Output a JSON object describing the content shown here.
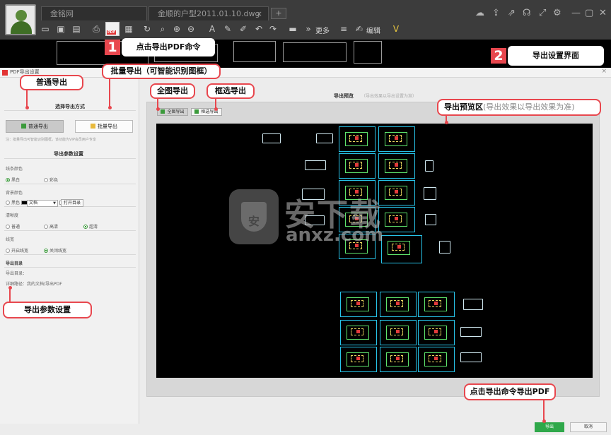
{
  "tabs": [
    {
      "label": "金铭网"
    },
    {
      "label": "金顺的户型2011.01.10.dwg",
      "close": "×"
    }
  ],
  "tab_add": "+",
  "toolbar": {
    "more_label": "更多",
    "edit_label": "编辑",
    "pdf_tag": "PDF"
  },
  "callouts": {
    "step1_number": "1",
    "step1_text": "点击导出PDF命令",
    "step2_number": "2",
    "step2_text": "导出设置界面",
    "batch_text": "批量导出（可智能识别图框）",
    "normal_text": "普通导出",
    "full_text": "全图导出",
    "frame_text": "框选导出",
    "preview_text": "导出预览区",
    "preview_note": "(导出效果以导出效果为准)",
    "params_text": "导出参数设置",
    "export_cmd_text": "点击导出命令导出PDF"
  },
  "dialog": {
    "title": "PDF导出设置",
    "close": "×",
    "export_mode_title": "选择导出方式",
    "normal_export": "普通导出",
    "batch_export": "批量导出",
    "batch_note": "注：批量导出可智能识别图框，该功能为VIP会员用户专享",
    "params_title": "导出参数设置",
    "line_color": {
      "label": "线条颜色",
      "options": [
        "黑白",
        "彩色"
      ],
      "selected": "黑白"
    },
    "bg_color": {
      "label": "背景颜色",
      "options": [
        "黑色",
        "白色"
      ],
      "selected": "白色"
    },
    "clarity": {
      "label": "清晰度",
      "options": [
        "普通",
        "高清",
        "超清"
      ],
      "selected": "超清"
    },
    "linewidth": {
      "label": "线宽",
      "options": [
        "开启线宽",
        "关闭线宽"
      ],
      "selected": "关闭线宽"
    },
    "dir_title": "导出目录",
    "dir_label": "导出目录：",
    "dir_value": "文档",
    "open_dir": "打开目录",
    "path_text": "详细路径：我的文档\\导出PDF",
    "preview_title": "导出预览",
    "preview_sub": "（导出效果以导出设置为准）",
    "btn_full": "全图导出",
    "btn_frame": "框选导出",
    "btn_export": "导出",
    "btn_cancel": "取消"
  },
  "watermark": {
    "text": "安下载",
    "url": "anxz.com",
    "shield_char": "安"
  },
  "colors": {
    "callout_red": "#e8474e",
    "export_green": "#2fa84a",
    "cad_cyan": "#27c3e8",
    "cad_green": "#5ee36b"
  },
  "icons": [
    "pdf-icon",
    "open-icon",
    "save-icon",
    "print-icon",
    "zoom-icon",
    "undo-icon",
    "redo-icon",
    "cloud-icon",
    "upload-icon",
    "share-icon",
    "headset-icon",
    "fullscreen-icon",
    "settings-icon",
    "minimize-icon",
    "maximize-icon",
    "close-icon"
  ]
}
